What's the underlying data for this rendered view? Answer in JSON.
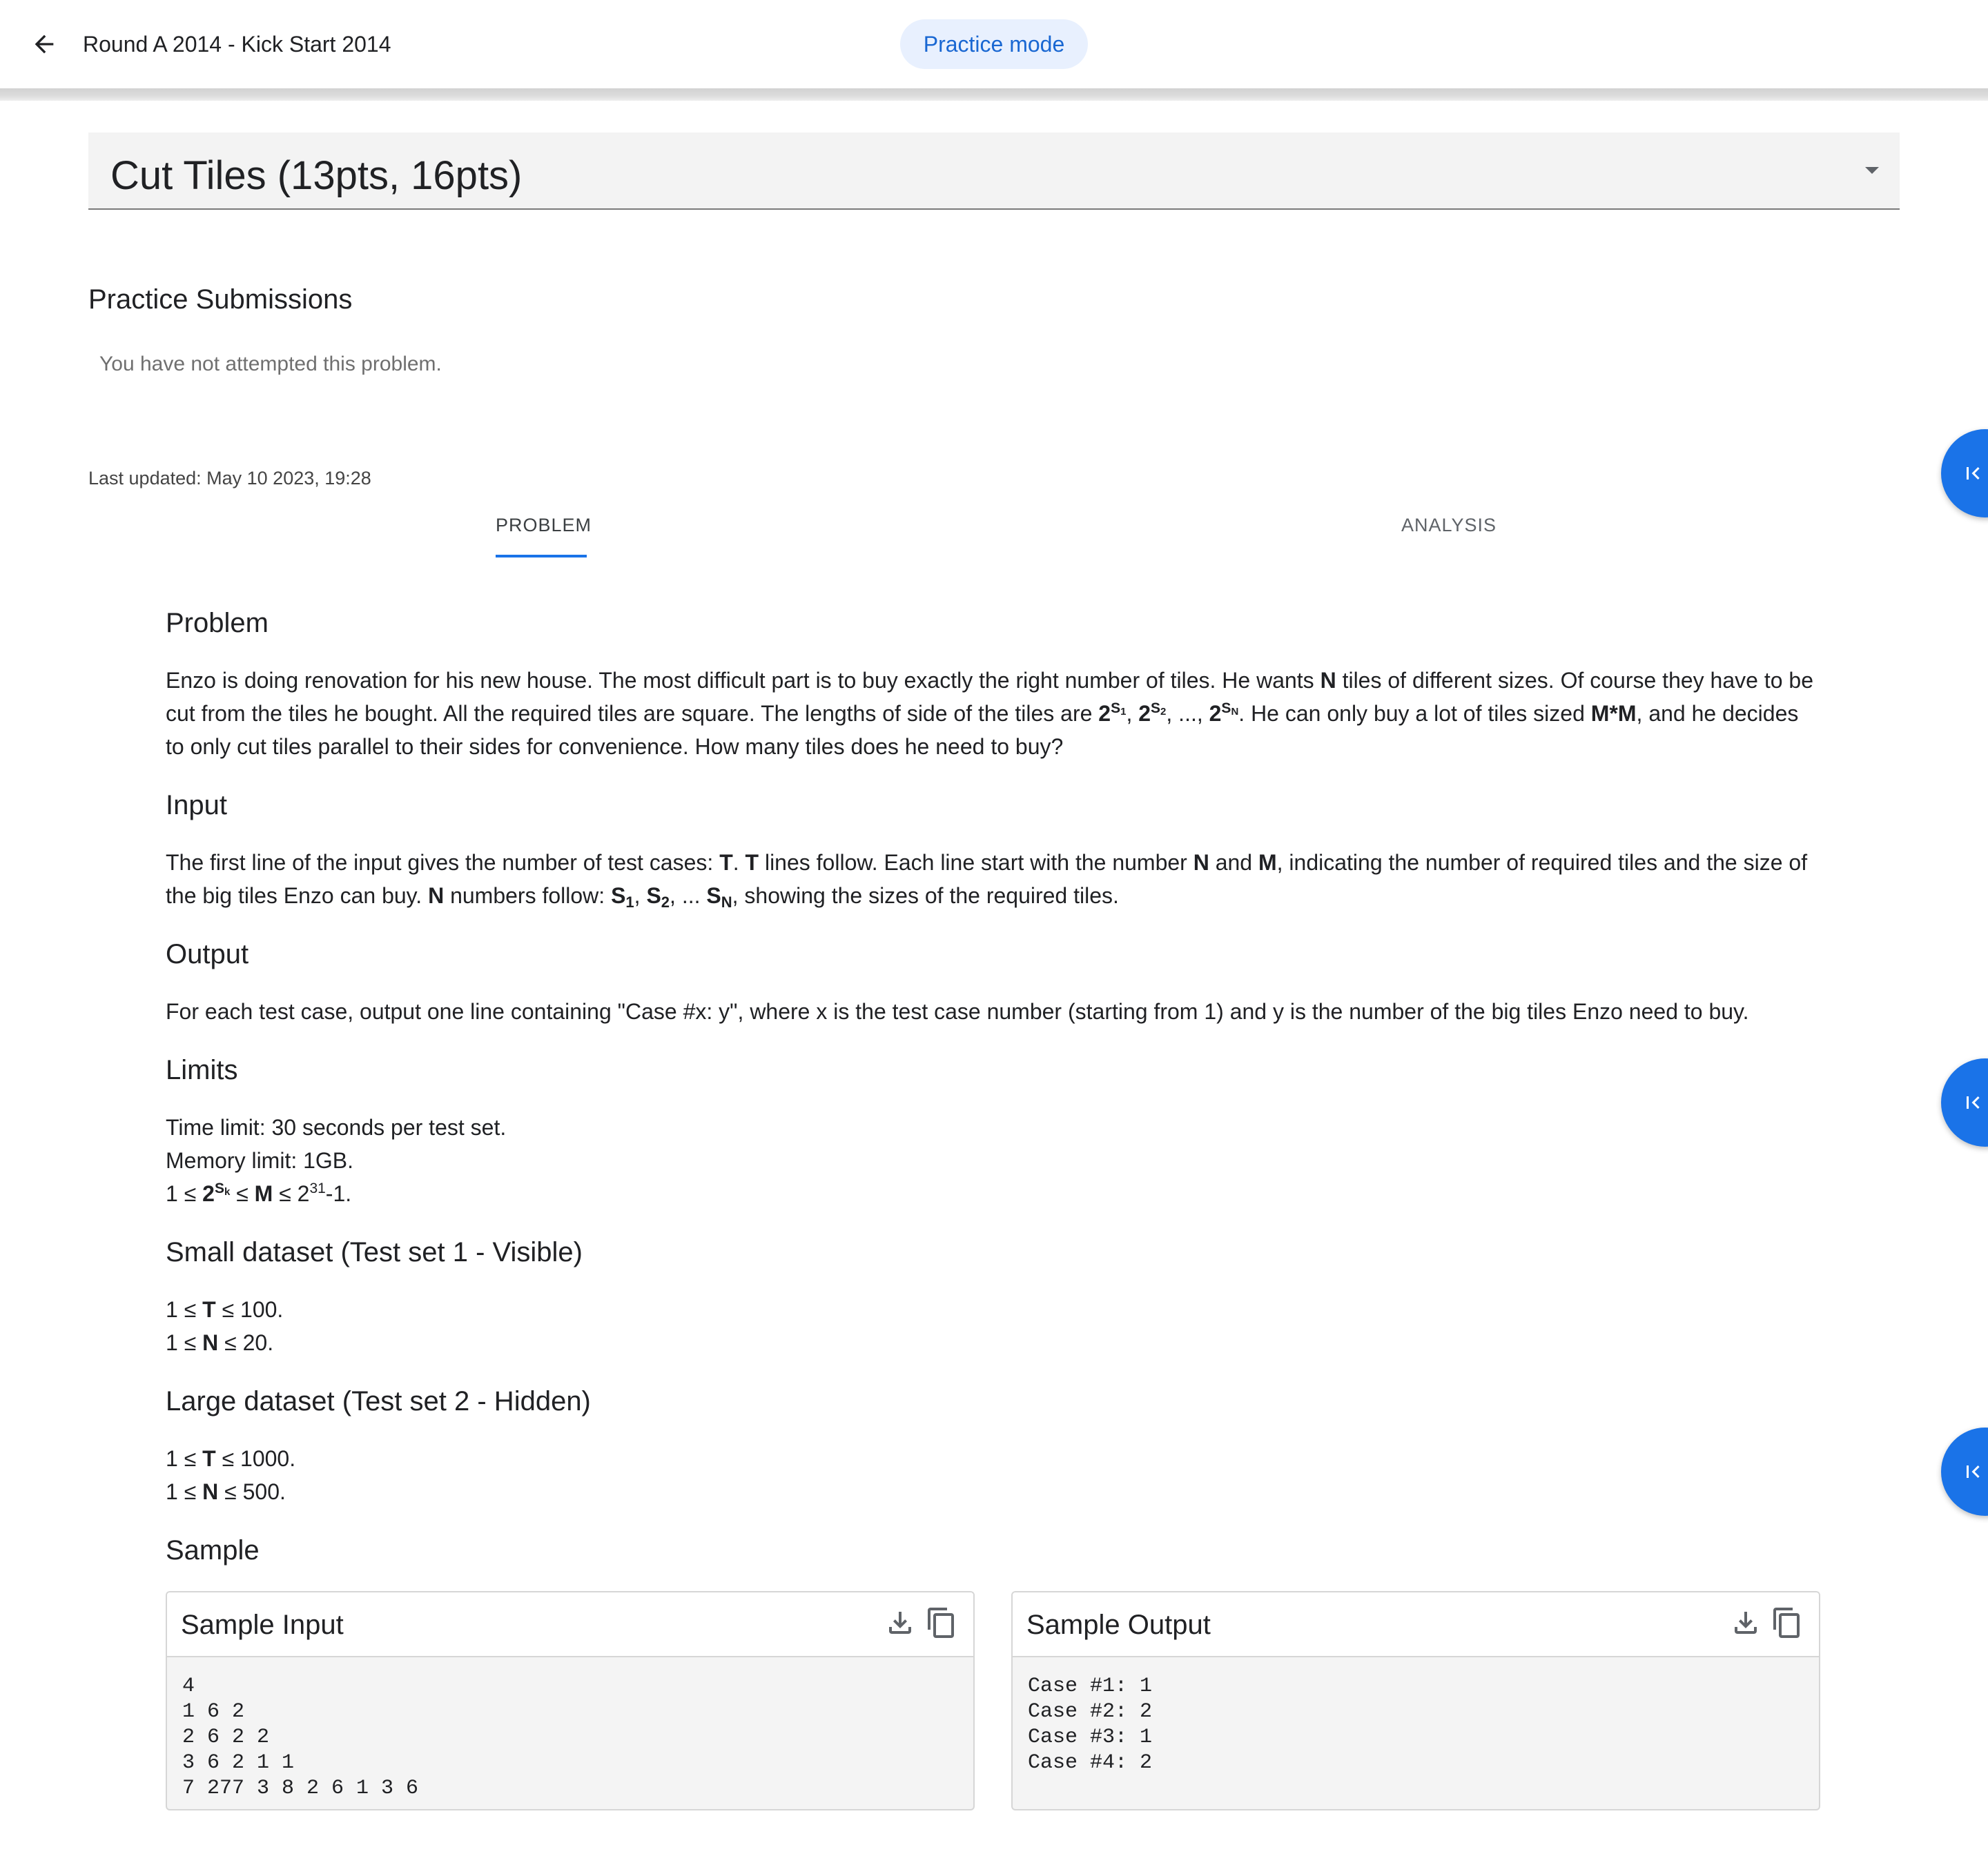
{
  "header": {
    "round_title": "Round A 2014 - Kick Start 2014",
    "mode_chip": "Practice mode"
  },
  "problem_selector": {
    "selected": "Cut Tiles (13pts, 16pts)"
  },
  "submissions": {
    "heading": "Practice Submissions",
    "note": "You have not attempted this problem."
  },
  "last_updated": "Last updated: May 10 2023, 19:28",
  "tabs": [
    {
      "label": "PROBLEM",
      "active": true
    },
    {
      "label": "ANALYSIS",
      "active": false
    }
  ],
  "statement": {
    "problem_heading": "Problem",
    "problem_text": {
      "p1": "Enzo is doing renovation for his new house. The most difficult part is to buy exactly the right number of tiles. He wants ",
      "N": "N",
      "p2": " tiles of different sizes. Of course they have to be cut from the tiles he bought. All the required tiles are square. The lengths of side of the tiles are ",
      "two": "2",
      "S": "S",
      "sub1": "1",
      "sub2": "2",
      "subN": "N",
      "sep": ", ",
      "dots": ", ..., ",
      "p3": ". He can only buy a lot of tiles sized ",
      "MM": "M*M",
      "p4": ", and he decides to only cut tiles parallel to their sides for convenience. How many tiles does he need to buy?"
    },
    "input_heading": "Input",
    "input_text": {
      "p1": "The first line of the input gives the number of test cases: ",
      "T": "T",
      "p2": ". ",
      "p3": " lines follow. Each line start with the number ",
      "N": "N",
      "p4": " and ",
      "M": "M",
      "p5": ", indicating the number of required tiles and the size of the big tiles Enzo can buy. ",
      "p6": " numbers follow: ",
      "S": "S",
      "sub1": "1",
      "sub2": "2",
      "subN": "N",
      "sep": ", ",
      "dots": ", ... ",
      "p7": ", showing the sizes of the required tiles."
    },
    "output_heading": "Output",
    "output_text": "For each test case, output one line containing \"Case #x: y\", where x is the test case number (starting from 1) and y is the number of the big tiles Enzo need to buy.",
    "limits_heading": "Limits",
    "limits": {
      "time": "Time limit: 30 seconds per test set.",
      "memory": "Memory limit: 1GB.",
      "c_pre": "1 ≤ ",
      "two": "2",
      "S": "S",
      "k": "k",
      "c_mid": " ≤ ",
      "M": "M",
      "c_mid2": " ≤ 2",
      "exp": "31",
      "c_post": "-1."
    },
    "small_heading": "Small dataset (Test set 1 - Visible)",
    "small": {
      "pre": "1 ≤ ",
      "T": "T",
      "t_post": " ≤ 100.",
      "N": "N",
      "n_post": " ≤ 20."
    },
    "large_heading": "Large dataset (Test set 2 - Hidden)",
    "large": {
      "pre": "1 ≤ ",
      "T": "T",
      "t_post": " ≤ 1000.",
      "N": "N",
      "n_post": " ≤ 500."
    },
    "sample_heading": "Sample"
  },
  "sample_input": {
    "title": "Sample Input",
    "content": "4\n1 6 2\n2 6 2 2\n3 6 2 1 1\n7 277 3 8 2 6 1 3 6"
  },
  "sample_output": {
    "title": "Sample Output",
    "content": "Case #1: 1\nCase #2: 2\nCase #3: 1\nCase #4: 2"
  },
  "icons": {
    "back": "arrow-back-icon",
    "dropdown": "arrow-drop-down-icon",
    "fab": "first-page-icon",
    "download": "download-icon",
    "copy": "copy-icon"
  },
  "colors": {
    "accent": "#1a73e8",
    "chip_bg": "#e8f0fe",
    "chip_text": "#1967d2"
  }
}
